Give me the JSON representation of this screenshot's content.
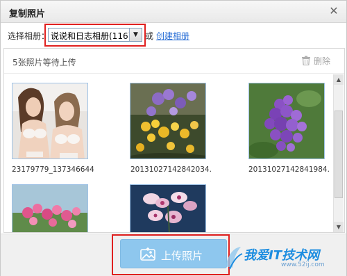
{
  "window": {
    "title": "复制照片",
    "close_symbol": "✕"
  },
  "album": {
    "label": "选择相册：",
    "selected": "说说和日志相册(116)",
    "dropdown_arrow": "▼",
    "or_text": "或",
    "create_link": "创建相册"
  },
  "panel": {
    "waiting_text": "5张照片等待上传",
    "delete_label": "删除"
  },
  "photos": [
    {
      "caption": "23179779_137346644",
      "subject": "two women"
    },
    {
      "caption": "20131027142842034.",
      "subject": "yellow and purple flowers"
    },
    {
      "caption": "20131027142841984.",
      "subject": "purple lilac flowers"
    },
    {
      "caption": "",
      "subject": "pink flowers"
    },
    {
      "caption": "",
      "subject": "pink orchids"
    }
  ],
  "footer": {
    "upload_label": "上传照片"
  },
  "watermark": {
    "text": "我爱IT技术网",
    "url": "www.52ij.com"
  },
  "colors": {
    "accent_link": "#2a6fd6",
    "upload_button": "#8ec7ee",
    "highlight_box": "#e0201f",
    "watermark": "#1d8de0"
  }
}
